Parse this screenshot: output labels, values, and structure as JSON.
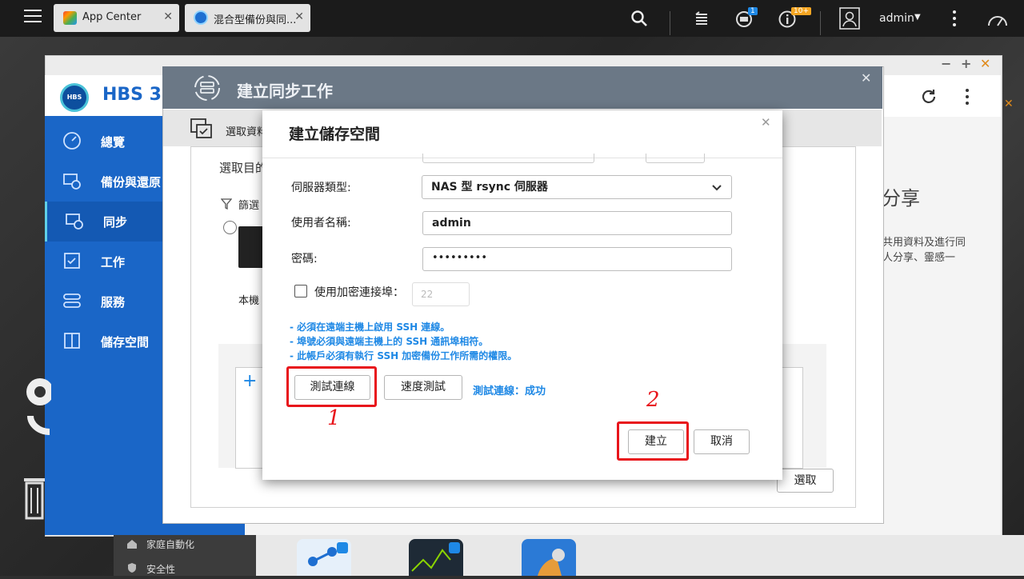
{
  "topbar": {
    "tabs": [
      {
        "label": "App Center"
      },
      {
        "label": "混合型備份與同..."
      }
    ],
    "badge_tasks": "1",
    "badge_notifications": "10+",
    "user": "admin"
  },
  "app_window": {
    "app_name": "HBS 3",
    "sidebar": [
      {
        "label": "總覽"
      },
      {
        "label": "備份與還原"
      },
      {
        "label": "同步"
      },
      {
        "label": "工作"
      },
      {
        "label": "服務"
      },
      {
        "label": "儲存空間"
      }
    ],
    "right_heading": "分享",
    "right_text_1": "共用資料及進行同",
    "right_text_2": "人分享、靈感一"
  },
  "sync_window": {
    "title": "建立同步工作",
    "step_label": "選取資料",
    "section_title": "選取目的",
    "filter_label": "篩選",
    "local_label": "本機",
    "select_button": "選取"
  },
  "dialog": {
    "title": "建立儲存空間",
    "server_type_label": "伺服器類型:",
    "server_type_value": "NAS 型 rsync 伺服器",
    "username_label": "使用者名稱:",
    "username_value": "admin",
    "password_label": "密碼:",
    "password_value": "•••••••••",
    "encrypted_port_label": "使用加密連接埠：",
    "encrypted_port_value": "22",
    "notes": [
      "- 必須在遠端主機上啟用 SSH 連線。",
      "- 埠號必須與遠端主機上的 SSH 通訊埠相符。",
      "- 此帳戶必須有執行 SSH 加密備份工作所需的權限。"
    ],
    "test_button": "測試連線",
    "speed_button": "速度測試",
    "test_result": "測試連線：成功",
    "create_button": "建立",
    "cancel_button": "取消"
  },
  "annotations": {
    "first": "1",
    "second": "2"
  },
  "desktop_bottom": {
    "items": [
      {
        "label": "家庭自動化"
      },
      {
        "label": "安全性"
      }
    ]
  },
  "colors": {
    "accent": "#1e88e5",
    "sidebar": "#1a66c7",
    "highlight": "#e8141b"
  }
}
